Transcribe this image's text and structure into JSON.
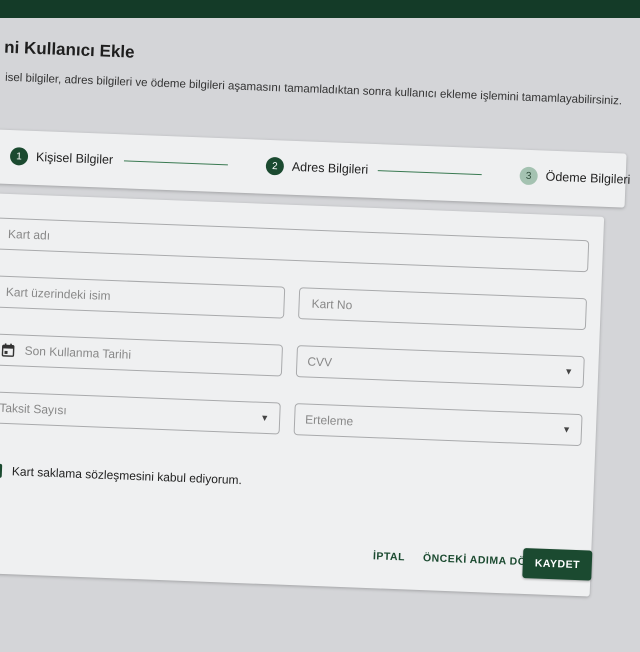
{
  "page": {
    "title": "ni Kullanıcı Ekle",
    "subtitle": "isel bilgiler, adres bilgileri ve ödeme bilgileri aşamasını tamamladıktan sonra kullanıcı ekleme işlemini tamamlayabilirsiniz."
  },
  "stepper": {
    "steps": [
      {
        "number": "1",
        "label": "Kişisel Bilgiler",
        "state": "complete"
      },
      {
        "number": "2",
        "label": "Adres Bilgileri",
        "state": "active"
      },
      {
        "number": "3",
        "label": "Ödeme Bilgileri",
        "state": "pending"
      }
    ]
  },
  "form": {
    "card_name": {
      "placeholder": "Kart adı",
      "value": ""
    },
    "card_holder": {
      "placeholder": "Kart üzerindeki isim",
      "value": ""
    },
    "card_number": {
      "placeholder": "Kart No",
      "value": ""
    },
    "expiry": {
      "placeholder": "Son Kullanma Tarihi",
      "icon": "calendar-icon",
      "value": ""
    },
    "cvv": {
      "placeholder": "CVV",
      "value": ""
    },
    "installments": {
      "placeholder": "Taksit Sayısı",
      "value": ""
    },
    "deferral": {
      "placeholder": "Erteleme",
      "value": ""
    },
    "agreement": {
      "label": "Kart saklama sözleşmesini kabul ediyorum.",
      "checked": true
    }
  },
  "actions": {
    "cancel": "İPTAL",
    "previous": "ÖNCEKİ ADIMA DÖN",
    "save": "KAYDET"
  },
  "colors": {
    "primary": "#1b4a30",
    "topbar": "#143b28",
    "background": "#d4d5d8",
    "card": "#eff0f1"
  }
}
